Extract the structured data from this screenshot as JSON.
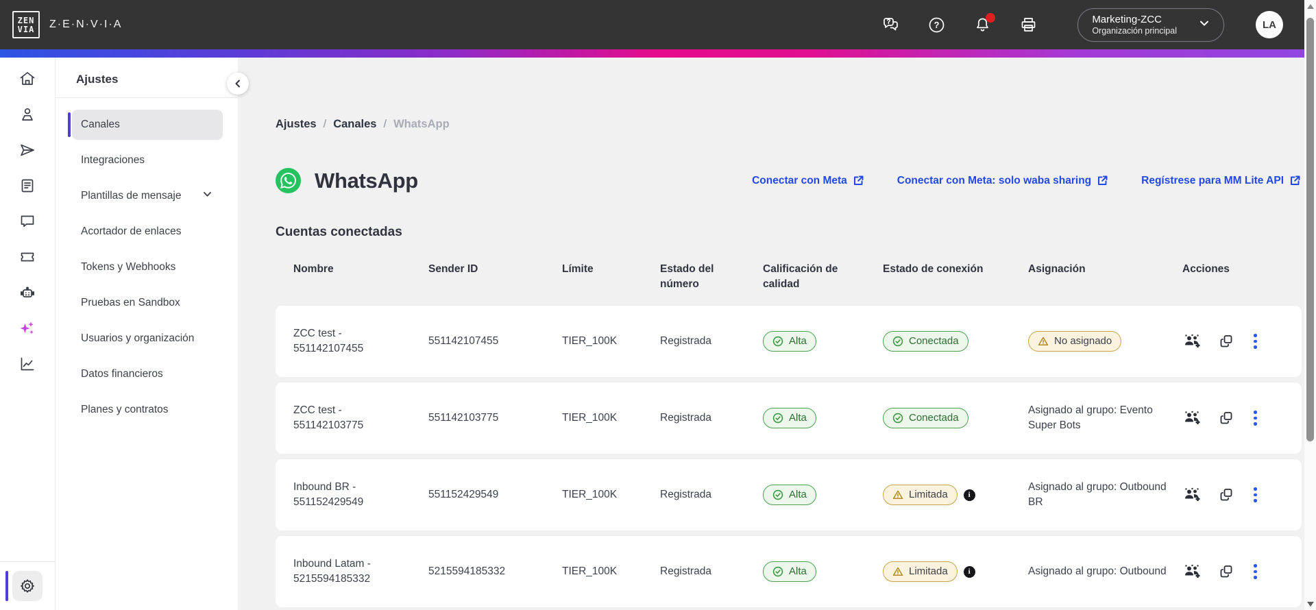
{
  "header": {
    "logo_text": "Z·E·N·V·I·A",
    "logo_glyph_top": "ZEN",
    "logo_glyph_bottom": "VIA",
    "org": {
      "name": "Marketing-ZCC",
      "subtitle": "Organización principal"
    },
    "avatar_initials": "LA"
  },
  "sidebar": {
    "title": "Ajustes",
    "items": [
      {
        "label": "Canales",
        "active": true
      },
      {
        "label": "Integraciones"
      },
      {
        "label": "Plantillas de mensaje",
        "expandable": true
      },
      {
        "label": "Acortador de enlaces"
      },
      {
        "label": "Tokens y Webhooks"
      },
      {
        "label": "Pruebas en Sandbox"
      },
      {
        "label": "Usuarios y organización"
      },
      {
        "label": "Datos financieros"
      },
      {
        "label": "Planes y contratos"
      }
    ]
  },
  "breadcrumb": {
    "items": [
      "Ajustes",
      "Canales",
      "WhatsApp"
    ]
  },
  "page": {
    "title": "WhatsApp",
    "links": [
      {
        "label": "Conectar con Meta"
      },
      {
        "label": "Conectar con Meta: solo waba sharing"
      },
      {
        "label": "Regístrese para MM Lite API"
      }
    ],
    "section_title": "Cuentas conectadas"
  },
  "table": {
    "columns": [
      "Nombre",
      "Sender ID",
      "Límite",
      "Estado del número",
      "Calificación de calidad",
      "Estado de conexión",
      "Asignación",
      "Acciones"
    ],
    "rows": [
      {
        "nombre": "ZCC test - 551142107455",
        "sender_id": "551142107455",
        "limite": "TIER_100K",
        "estado_numero": "Registrada",
        "calidad": "Alta",
        "conexion": "Conectada",
        "conexion_status": "ok",
        "conexion_info": false,
        "asignacion": "No asignado",
        "asignacion_badge": true
      },
      {
        "nombre": "ZCC test - 551142103775",
        "sender_id": "551142103775",
        "limite": "TIER_100K",
        "estado_numero": "Registrada",
        "calidad": "Alta",
        "conexion": "Conectada",
        "conexion_status": "ok",
        "conexion_info": false,
        "asignacion": "Asignado al grupo: Evento Super Bots",
        "asignacion_badge": false
      },
      {
        "nombre": "Inbound BR - 551152429549",
        "sender_id": "551152429549",
        "limite": "TIER_100K",
        "estado_numero": "Registrada",
        "calidad": "Alta",
        "conexion": "Limitada",
        "conexion_status": "warn",
        "conexion_info": true,
        "asignacion": "Asignado al grupo: Outbound BR",
        "asignacion_badge": false
      },
      {
        "nombre": "Inbound Latam - 5215594185332",
        "sender_id": "5215594185332",
        "limite": "TIER_100K",
        "estado_numero": "Registrada",
        "calidad": "Alta",
        "conexion": "Limitada",
        "conexion_status": "warn",
        "conexion_info": true,
        "asignacion": "Asignado al grupo: Outbound",
        "asignacion_badge": false
      }
    ]
  },
  "colors": {
    "header_bg": "#343434",
    "accent_indigo": "#4f3cdd",
    "link_blue": "#2348e6",
    "whatsapp_green": "#25c25f",
    "ok_pill_border": "#4ca24f",
    "warn_pill_border": "#c9a44c",
    "notification_red": "#e02020",
    "gradient": [
      "#2d54e4",
      "#8c2bc8",
      "#e60b8b",
      "#9046e0"
    ]
  }
}
